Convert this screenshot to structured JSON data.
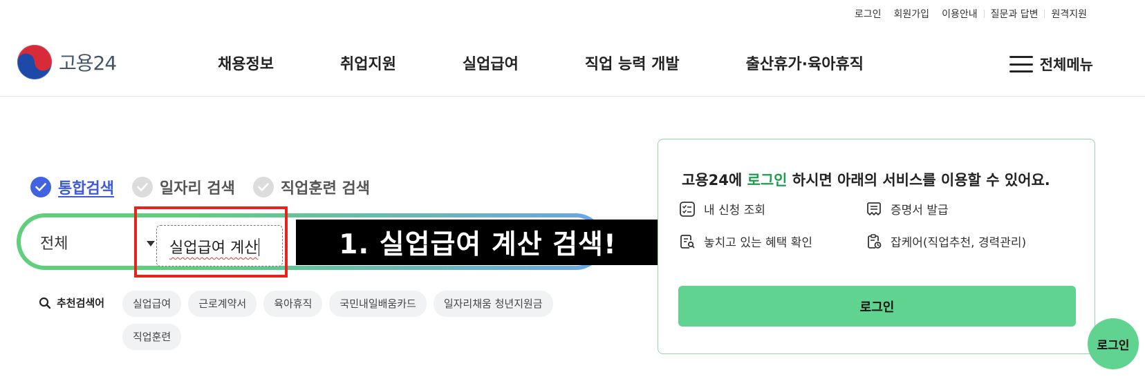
{
  "util_links": [
    "로그인",
    "회원가입",
    "이용안내",
    "질문과 답변",
    "원격지원"
  ],
  "logo": {
    "text": "고용24"
  },
  "gnb": [
    "채용정보",
    "취업지원",
    "실업급여",
    "직업 능력 개발",
    "출산휴가·육아휴직"
  ],
  "all_menu_label": "전체메뉴",
  "scopes": [
    "통합검색",
    "일자리 검색",
    "직업훈련 검색"
  ],
  "search": {
    "scope_value": "전체",
    "query_value": "실업급여 계산"
  },
  "annotation_banner": "1. 실업급여 계산 검색!",
  "recommended": {
    "label": "추천검색어",
    "keywords": [
      "실업급여",
      "근로계약서",
      "육아휴직",
      "국민내일배움카드",
      "일자리채움 청년지원금",
      "직업훈련"
    ]
  },
  "login_panel": {
    "title_prefix": "고용24에 ",
    "title_link": "로그인",
    "title_suffix": " 하시면 아래의 서비스를 이용할 수 있어요.",
    "services": [
      "내 신청 조회",
      "증명서 발급",
      "놓치고 있는 혜택 확인",
      "잡케어(직업추천, 경력관리)"
    ],
    "button_label": "로그인"
  },
  "floating_button_label": "로그인",
  "colors": {
    "accent_green": "#5fd38f",
    "accent_blue": "#4263e0",
    "annotation_red": "#e8231d"
  }
}
